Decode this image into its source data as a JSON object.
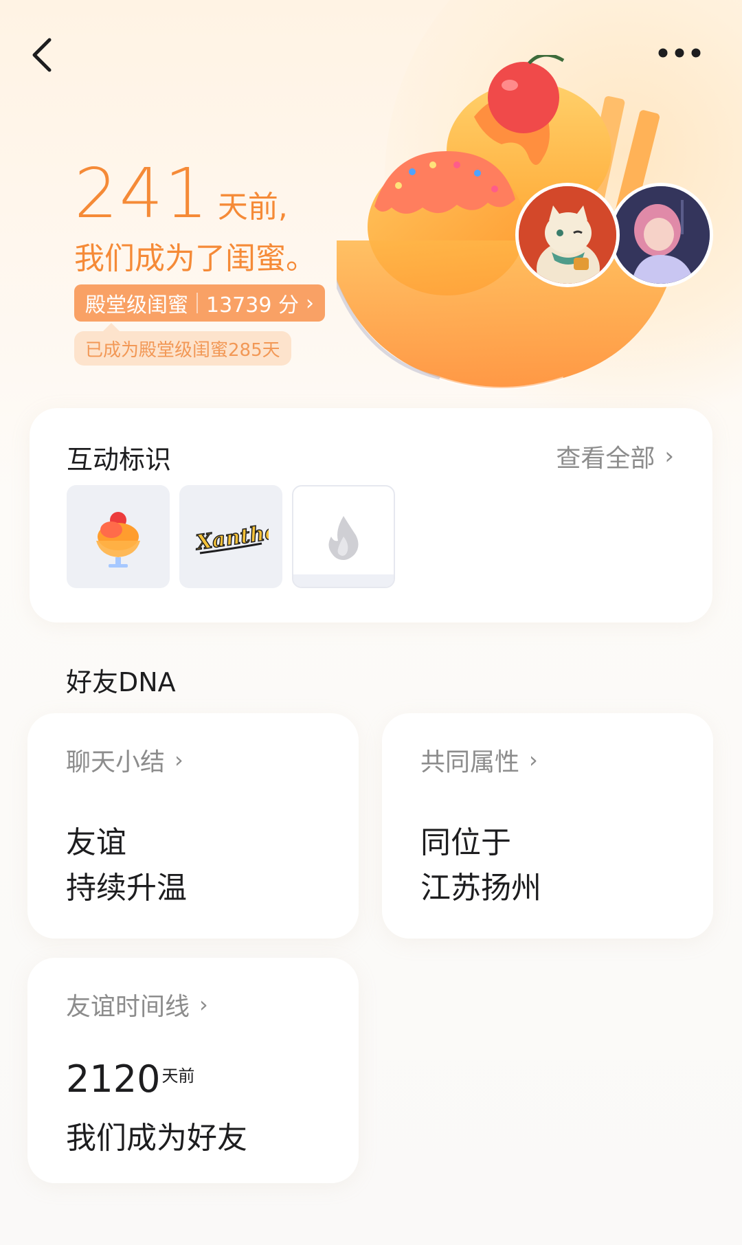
{
  "header": {
    "days": "241",
    "days_unit": "天前,",
    "subtitle": "我们成为了闺蜜。",
    "level_name": "殿堂级闺蜜",
    "level_score": "13739 分",
    "level_tip": "已成为殿堂级闺蜜285天",
    "icons": {
      "back": "back-arrow-icon",
      "more": "more-dots-icon"
    }
  },
  "interaction": {
    "title": "互动标识",
    "view_all": "查看全部",
    "badges": [
      {
        "name": "ice-cream-badge"
      },
      {
        "name": "xanthe-badge",
        "text": "Xanthe"
      },
      {
        "name": "flame-badge"
      }
    ]
  },
  "dna": {
    "section_title": "好友DNA",
    "chat_summary": {
      "label": "聊天小结",
      "line1": "友谊",
      "line2": "持续升温"
    },
    "common_attr": {
      "label": "共同属性",
      "line1": "同位于",
      "line2": "江苏扬州"
    },
    "timeline": {
      "label": "友谊时间线",
      "number": "2120",
      "unit": "天前",
      "line2": "我们成为好友"
    }
  },
  "colors": {
    "accent": "#f58a37",
    "pill": "#f9a165",
    "tip_bg": "#fde3cc",
    "muted": "#8c8c8c"
  }
}
